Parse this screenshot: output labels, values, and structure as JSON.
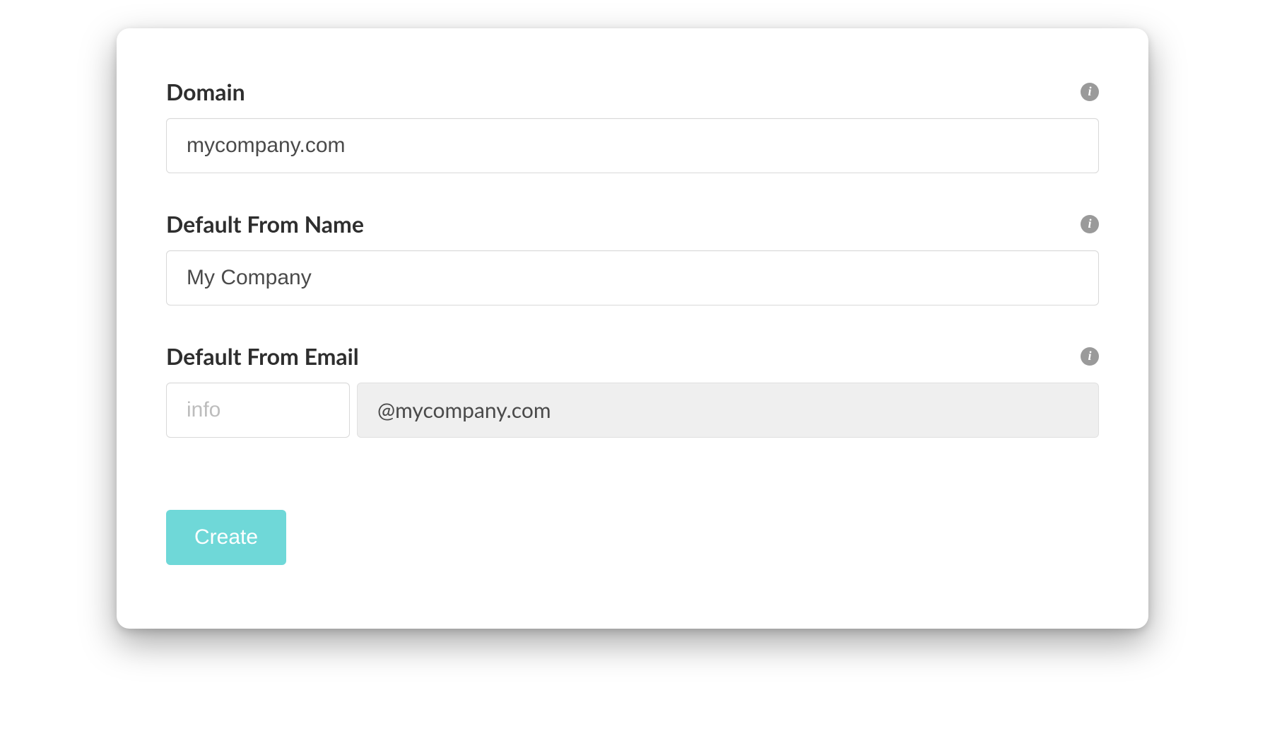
{
  "fields": {
    "domain": {
      "label": "Domain",
      "value": "mycompany.com"
    },
    "from_name": {
      "label": "Default From Name",
      "value": "My Company"
    },
    "from_email": {
      "label": "Default From Email",
      "local_placeholder": "info",
      "local_value": "",
      "addon": "@mycompany.com"
    }
  },
  "buttons": {
    "create": "Create"
  }
}
